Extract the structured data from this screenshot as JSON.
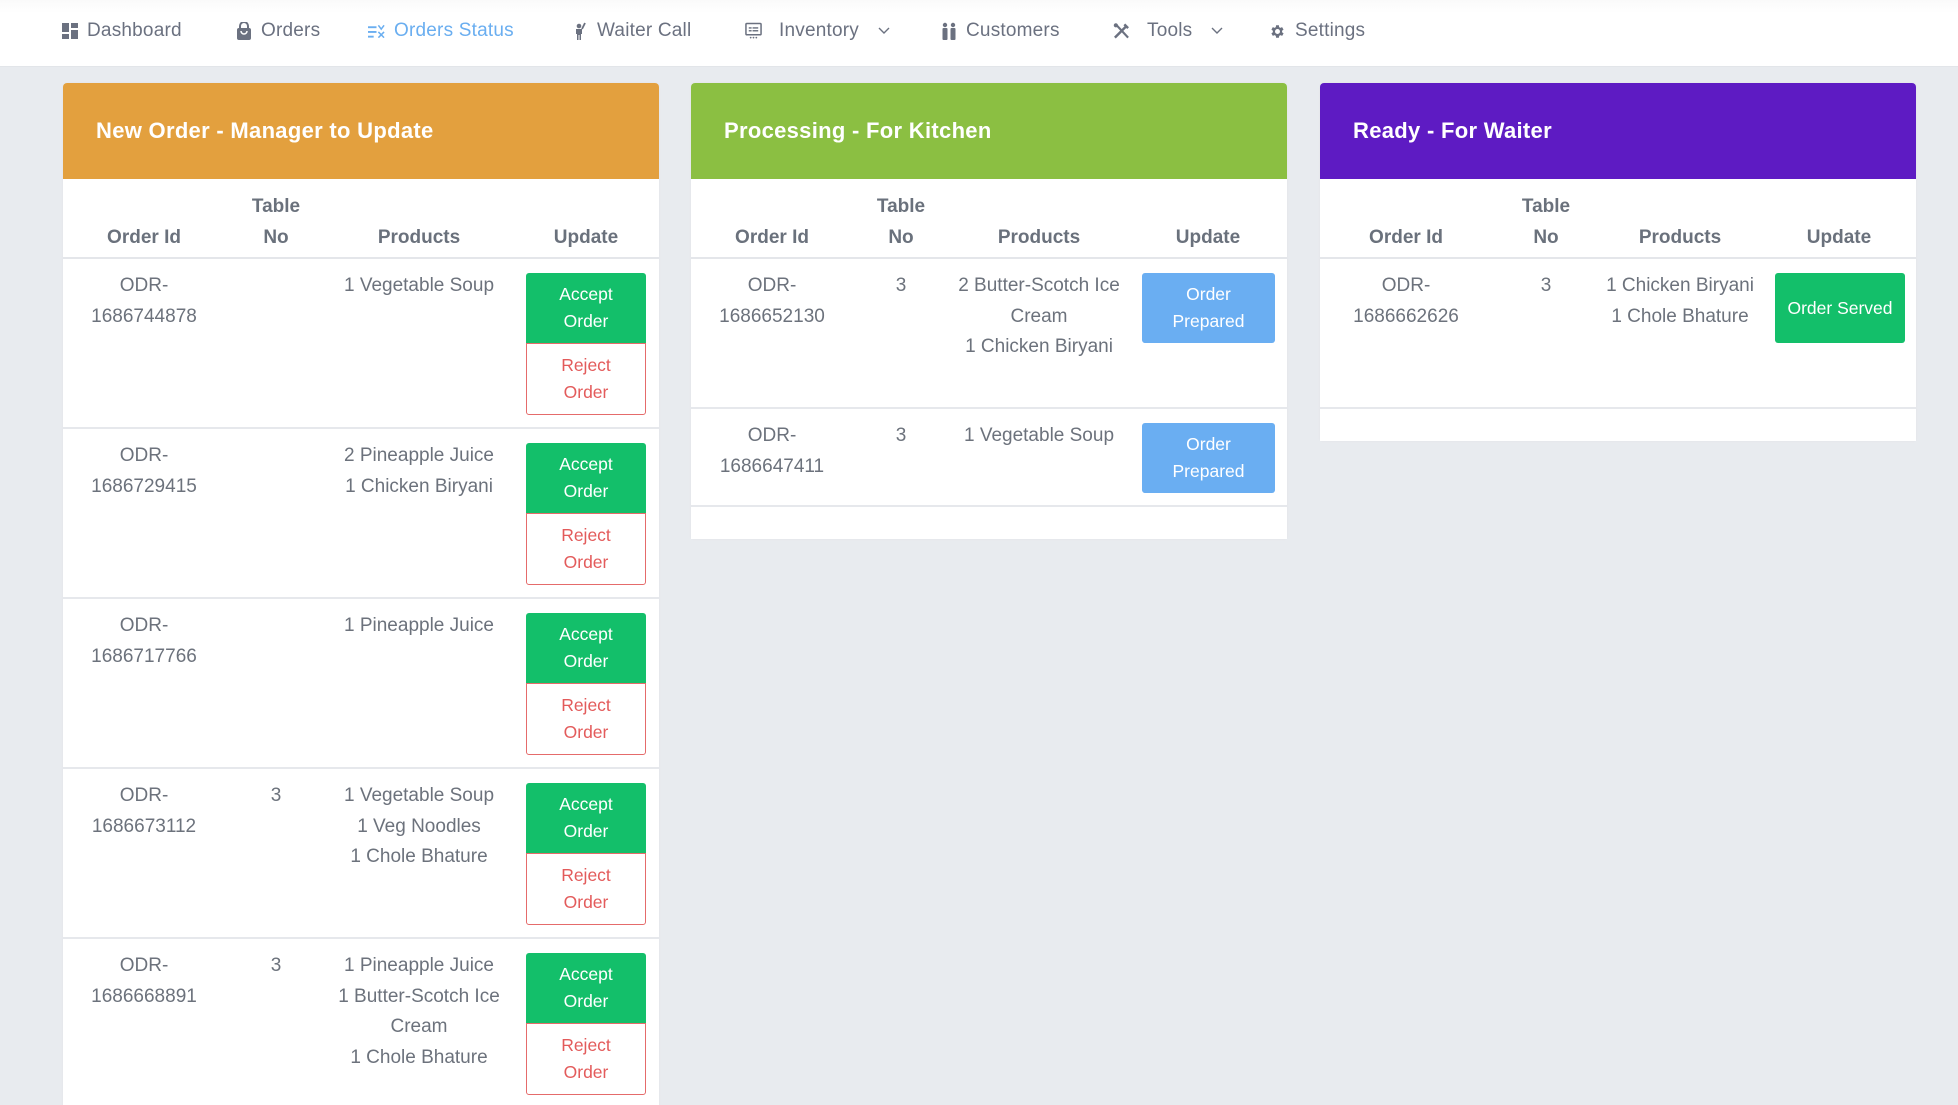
{
  "nav": {
    "items": [
      {
        "label": "Dashboard",
        "icon": "dashboard-icon",
        "active": false,
        "dropdown": false
      },
      {
        "label": "Orders",
        "icon": "shopping-bag-icon",
        "active": false,
        "dropdown": false
      },
      {
        "label": "Orders Status",
        "icon": "list-check-icon",
        "active": true,
        "dropdown": false
      },
      {
        "label": "Waiter Call",
        "icon": "waiter-icon",
        "active": false,
        "dropdown": false
      },
      {
        "label": "Inventory",
        "icon": "inventory-icon",
        "active": false,
        "dropdown": true
      },
      {
        "label": "Customers",
        "icon": "customers-icon",
        "active": false,
        "dropdown": false
      },
      {
        "label": "Tools",
        "icon": "tools-icon",
        "active": false,
        "dropdown": true
      },
      {
        "label": "Settings",
        "icon": "gear-icon",
        "active": false,
        "dropdown": false
      }
    ]
  },
  "colors": {
    "new_header": "#e3a03e",
    "processing_header": "#8bbf42",
    "ready_header": "#5e1bc3",
    "accept": "#13bf6a",
    "reject": "#e35b5b",
    "prepared": "#6aaef2",
    "active_nav": "#6aaef0"
  },
  "columns": {
    "order_id": "Order Id",
    "table_no_line1": "Table",
    "table_no_line2": "No",
    "products": "Products",
    "update": "Update"
  },
  "new_orders": {
    "title": "New Order - Manager to Update",
    "accept_label": "Accept Order",
    "reject_label": "Reject Order",
    "rows": [
      {
        "order_id_prefix": "ODR-",
        "order_id_num": "1686744878",
        "table_no": "",
        "products": [
          "1 Vegetable Soup"
        ]
      },
      {
        "order_id_prefix": "ODR-",
        "order_id_num": "1686729415",
        "table_no": "",
        "products": [
          "2 Pineapple Juice",
          "1 Chicken Biryani"
        ]
      },
      {
        "order_id_prefix": "ODR-",
        "order_id_num": "1686717766",
        "table_no": "",
        "products": [
          "1 Pineapple Juice"
        ]
      },
      {
        "order_id_prefix": "ODR-",
        "order_id_num": "1686673112",
        "table_no": "3",
        "products": [
          "1 Vegetable Soup",
          "1 Veg Noodles",
          "1 Chole Bhature"
        ]
      },
      {
        "order_id_prefix": "ODR-",
        "order_id_num": "1686668891",
        "table_no": "3",
        "products": [
          "1 Pineapple Juice",
          "1 Butter-Scotch Ice Cream",
          "1 Chole Bhature"
        ]
      }
    ]
  },
  "processing": {
    "title": "Processing - For Kitchen",
    "action_label": "Order Prepared",
    "rows": [
      {
        "order_id_prefix": "ODR-",
        "order_id_num": "1686652130",
        "table_no": "3",
        "products": [
          "2 Butter-Scotch Ice Cream",
          "1 Chicken Biryani"
        ]
      },
      {
        "order_id_prefix": "ODR-",
        "order_id_num": "1686647411",
        "table_no": "3",
        "products": [
          "1 Vegetable Soup"
        ]
      }
    ]
  },
  "ready": {
    "title": "Ready - For Waiter",
    "action_label": "Order Served",
    "rows": [
      {
        "order_id_prefix": "ODR-",
        "order_id_num": "1686662626",
        "table_no": "3",
        "products": [
          "1 Chicken Biryani",
          "1 Chole Bhature"
        ]
      }
    ]
  }
}
